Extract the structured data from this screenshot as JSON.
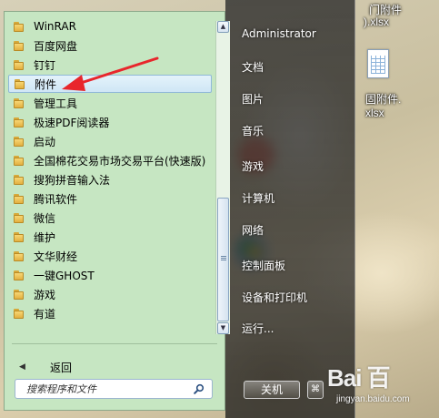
{
  "desktop": {
    "files": [
      {
        "label_line1": "门附件",
        "label_line2": ").xlsx"
      },
      {
        "label_line1": "固附件.",
        "label_line2": "xlsx"
      }
    ]
  },
  "start_menu": {
    "programs": [
      {
        "label": "WinRAR"
      },
      {
        "label": "百度网盘"
      },
      {
        "label": "钉钉"
      },
      {
        "label": "附件"
      },
      {
        "label": "管理工具"
      },
      {
        "label": "极速PDF阅读器"
      },
      {
        "label": "启动"
      },
      {
        "label": "全国棉花交易市场交易平台(快速版)"
      },
      {
        "label": "搜狗拼音输入法"
      },
      {
        "label": "腾讯软件"
      },
      {
        "label": "微信"
      },
      {
        "label": "维护"
      },
      {
        "label": "文华财经"
      },
      {
        "label": "一键GHOST"
      },
      {
        "label": "游戏"
      },
      {
        "label": "有道"
      }
    ],
    "selected_index": 3,
    "back_label": "返回",
    "search_placeholder": "搜索程序和文件",
    "right_items": [
      {
        "label": "Administrator"
      },
      {
        "label": "文档"
      },
      {
        "label": "图片"
      },
      {
        "label": "音乐"
      },
      {
        "label": "游戏"
      },
      {
        "label": "计算机"
      },
      {
        "label": "网络"
      },
      {
        "label": "控制面板"
      },
      {
        "label": "设备和打印机"
      },
      {
        "label": "运行..."
      }
    ],
    "shutdown_label": "关机",
    "shutdown_arrow": "⌘"
  },
  "watermark": {
    "logo": "Bai 百",
    "url": "jingyan.baidu.com"
  },
  "colors": {
    "annotation_arrow": "#e8262c",
    "left_panel": "#c6e6c2",
    "selection": "#cfe6f5"
  }
}
